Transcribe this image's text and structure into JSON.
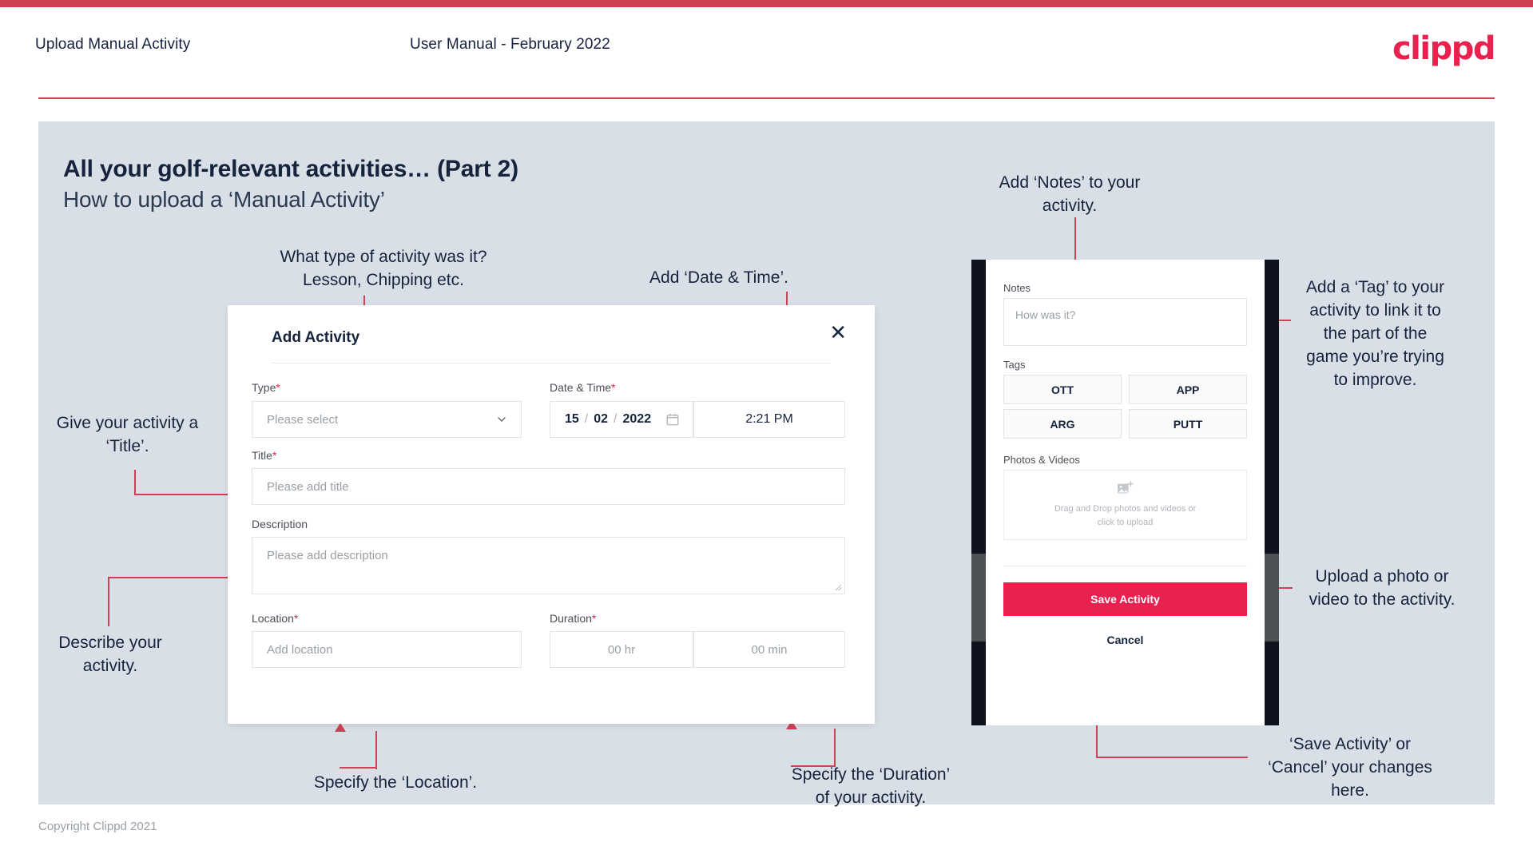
{
  "header": {
    "left_title": "Upload Manual Activity",
    "center_title": "User Manual - February 2022",
    "logo": "clippd"
  },
  "slide": {
    "title_line1": "All your golf-relevant activities… (Part 2)",
    "title_line2": "How to upload a ‘Manual Activity’"
  },
  "annotations": {
    "type": "What type of activity was it?\nLesson, Chipping etc.",
    "date_time": "Add ‘Date & Time’.",
    "notes": "Add ‘Notes’ to your\nactivity.",
    "tag": "Add a ‘Tag’ to your\nactivity to link it to\nthe part of the\ngame you’re trying\nto improve.",
    "title": "Give your activity a\n‘Title’.",
    "description": "Describe your\nactivity.",
    "upload": "Upload a photo or\nvideo to the activity.",
    "location": "Specify the ‘Location’.",
    "duration": "Specify the ‘Duration’\nof your activity.",
    "save_cancel": "‘Save Activity’ or\n‘Cancel’ your changes\nhere."
  },
  "dialog": {
    "title": "Add Activity",
    "close_icon": "✕",
    "fields": {
      "type_label": "Type",
      "type_placeholder": "Please select",
      "type_chevron": "⌄",
      "datetime_label": "Date & Time",
      "date_day": "15",
      "date_sep1": "/",
      "date_month": "02",
      "date_sep2": "/",
      "date_year": "2022",
      "calendar_icon": "calendar-icon",
      "time_value": "2:21 PM",
      "title_label": "Title",
      "title_placeholder": "Please add title",
      "description_label": "Description",
      "description_placeholder": "Please add description",
      "location_label": "Location",
      "location_placeholder": "Add location",
      "duration_label": "Duration",
      "duration_hours_placeholder": "00 hr",
      "duration_minutes_placeholder": "00 min"
    },
    "required_marker": "*"
  },
  "phone": {
    "notes_label": "Notes",
    "notes_placeholder": "How was it?",
    "tags_label": "Tags",
    "tags": [
      "OTT",
      "APP",
      "ARG",
      "PUTT"
    ],
    "photos_label": "Photos & Videos",
    "dropzone_text": "Drag and Drop photos and videos or\nclick to upload",
    "dropzone_icon": "image-add-icon",
    "save_label": "Save Activity",
    "cancel_label": "Cancel"
  },
  "footer": {
    "copyright": "Copyright Clippd 2021"
  },
  "colors": {
    "brand_pink": "#e8214f",
    "rule_pink": "#cf4055",
    "slide_bg": "#d9dfe6",
    "text_dark": "#15233c"
  }
}
